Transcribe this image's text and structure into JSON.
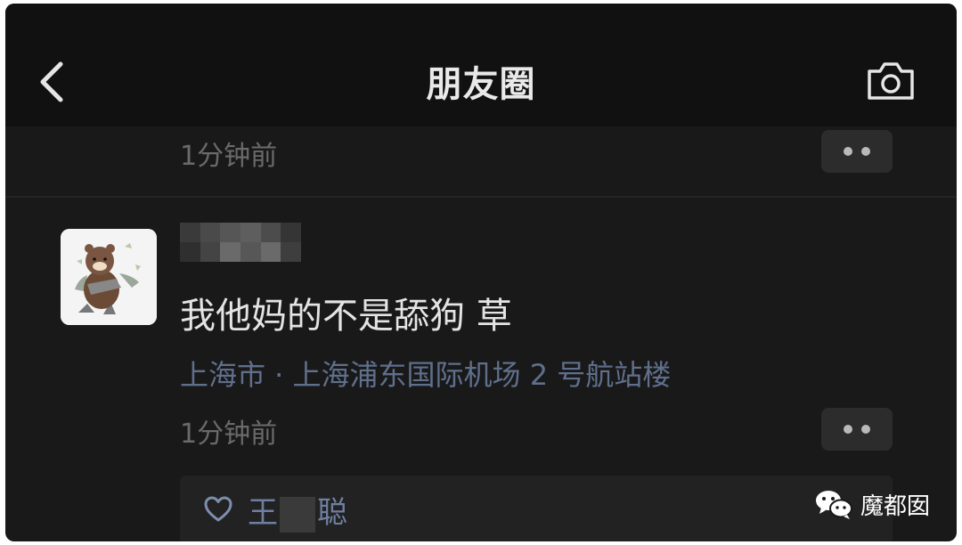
{
  "nav": {
    "title": "朋友圈",
    "back_icon": "chevron-left-icon",
    "camera_icon": "camera-icon"
  },
  "prev_post": {
    "time": "1分钟前"
  },
  "post": {
    "avatar": "cartoon-bear-avatar",
    "content": "我他妈的不是舔狗 草",
    "location": "上海市 · 上海浦东国际机场 2 号航站楼",
    "time": "1分钟前"
  },
  "likes": {
    "icon": "heart-icon",
    "name_first": "王",
    "name_last": "聪"
  },
  "watermark": {
    "text": "魔都囡",
    "icon": "wechat-icon"
  },
  "colors": {
    "background": "#191919",
    "navbar": "#111111",
    "link": "#5f6f8c",
    "text": "#e4e4e4",
    "muted": "#6a6a6a"
  }
}
